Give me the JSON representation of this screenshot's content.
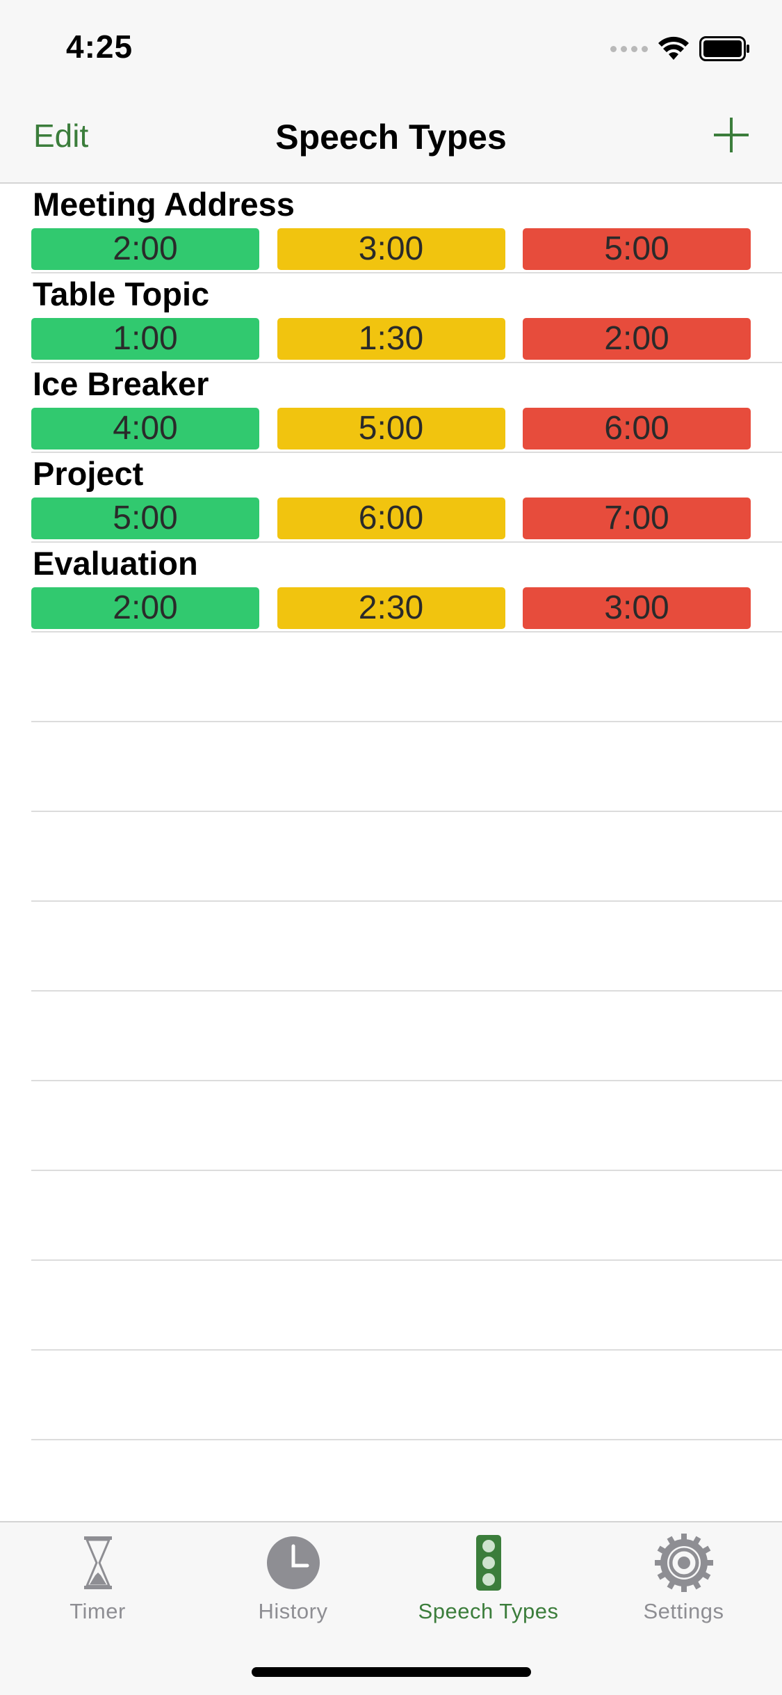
{
  "status_bar": {
    "time": "4:25"
  },
  "nav": {
    "edit_label": "Edit",
    "title": "Speech Types",
    "add_icon": "plus-icon"
  },
  "colors": {
    "accent": "#3b7d3b",
    "green": "#31c96f",
    "yellow": "#f1c40f",
    "red": "#e74c3c"
  },
  "speech_types": [
    {
      "name": "Meeting Address",
      "green": "2:00",
      "yellow": "3:00",
      "red": "5:00"
    },
    {
      "name": "Table Topic",
      "green": "1:00",
      "yellow": "1:30",
      "red": "2:00"
    },
    {
      "name": "Ice Breaker",
      "green": "4:00",
      "yellow": "5:00",
      "red": "6:00"
    },
    {
      "name": "Project",
      "green": "5:00",
      "yellow": "6:00",
      "red": "7:00"
    },
    {
      "name": "Evaluation",
      "green": "2:00",
      "yellow": "2:30",
      "red": "3:00"
    }
  ],
  "tabs": [
    {
      "label": "Timer",
      "icon": "hourglass-icon",
      "active": false
    },
    {
      "label": "History",
      "icon": "clock-icon",
      "active": false
    },
    {
      "label": "Speech Types",
      "icon": "traffic-light-icon",
      "active": true
    },
    {
      "label": "Settings",
      "icon": "gear-icon",
      "active": false
    }
  ]
}
